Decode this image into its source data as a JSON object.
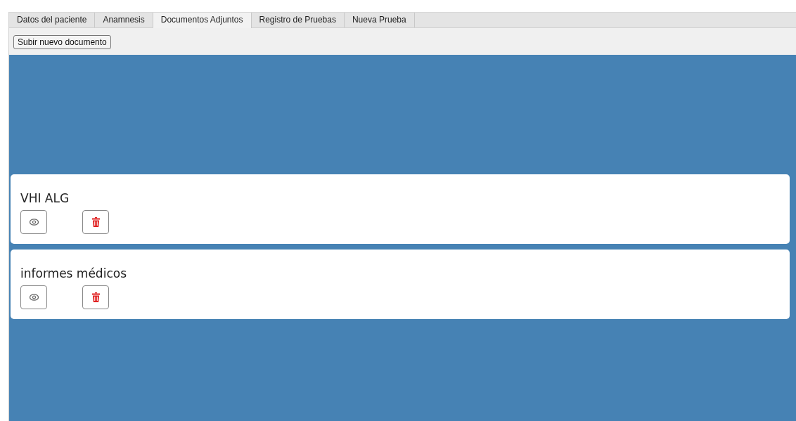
{
  "tabs": [
    {
      "label": "Datos del paciente",
      "selected": false
    },
    {
      "label": "Anamnesis",
      "selected": false
    },
    {
      "label": "Documentos Adjuntos",
      "selected": true
    },
    {
      "label": "Registro de Pruebas",
      "selected": false
    },
    {
      "label": "Nueva Prueba",
      "selected": false
    }
  ],
  "toolbar": {
    "upload_button": "Subir nuevo documento"
  },
  "documents": [
    {
      "title": "VHI ALG"
    },
    {
      "title": "informes médicos"
    }
  ]
}
